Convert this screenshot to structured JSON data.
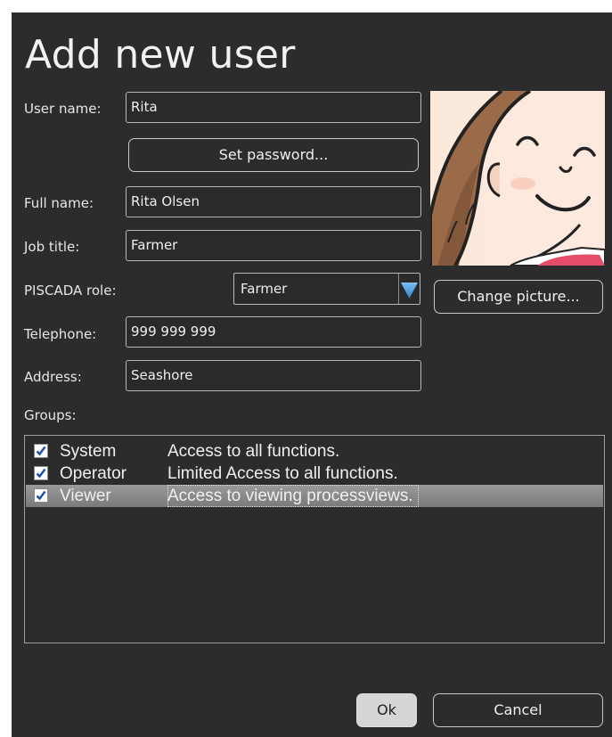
{
  "dialog": {
    "title": "Add new user",
    "labels": {
      "user_name": "User name:",
      "full_name": "Full name:",
      "job_title": "Job title:",
      "role": "PISCADA role:",
      "telephone": "Telephone:",
      "address": "Address:",
      "groups": "Groups:"
    },
    "fields": {
      "user_name": "Rita",
      "full_name": "Rita Olsen",
      "job_title": "Farmer",
      "telephone": "999 999 999",
      "address": "Seashore"
    },
    "role_selected": "Farmer",
    "buttons": {
      "set_password": "Set password...",
      "change_picture": "Change picture...",
      "ok": "Ok",
      "cancel": "Cancel"
    },
    "groups": [
      {
        "name": "System",
        "description": "Access to all functions.",
        "checked": true,
        "selected": false
      },
      {
        "name": "Operator",
        "description": "Limited Access to all functions.",
        "checked": true,
        "selected": false
      },
      {
        "name": "Viewer",
        "description": "Access to viewing processviews.",
        "checked": true,
        "selected": true
      }
    ],
    "colors": {
      "background": "#2c2c2c",
      "combo_arrow": "#3d8fd6",
      "selection": "#8a8a8a"
    },
    "icons": {
      "combo_arrow": "triangle-down-icon",
      "checkbox": "checkmark-icon"
    }
  }
}
